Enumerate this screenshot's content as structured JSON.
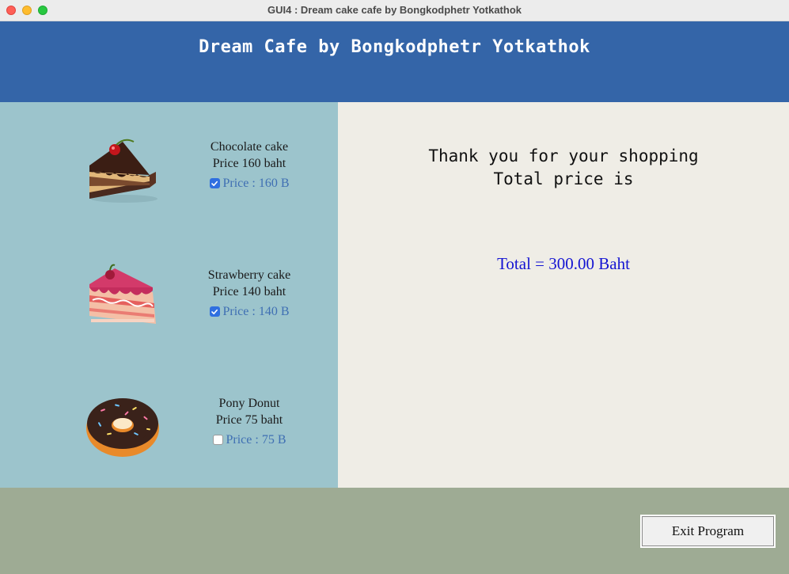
{
  "window": {
    "title": "GUI4 : Dream cake cafe by Bongkodphetr Yotkathok"
  },
  "header": {
    "title": "Dream Cafe by Bongkodphetr Yotkathok"
  },
  "items": [
    {
      "name": "Chocolate cake",
      "price_text": "Price 160 baht",
      "checkbox_label": "Price : 160 B",
      "checked": true,
      "icon": "chocolate-cake-icon"
    },
    {
      "name": "Strawberry cake",
      "price_text": "Price 140 baht",
      "checkbox_label": "Price : 140 B",
      "checked": true,
      "icon": "strawberry-cake-icon"
    },
    {
      "name": "Pony Donut",
      "price_text": "Price 75 baht",
      "checkbox_label": "Price : 75 B",
      "checked": false,
      "icon": "donut-icon"
    }
  ],
  "summary": {
    "thanks_line1": "Thank you for your shopping",
    "thanks_line2": "Total price is",
    "total": "Total = 300.00 Baht"
  },
  "footer": {
    "exit_label": "Exit Program"
  },
  "colors": {
    "header_bg": "#3465a8",
    "left_panel_bg": "#9cc4cc",
    "right_panel_bg": "#efede6",
    "footer_bg": "#9eab94",
    "total_text": "#1414d2",
    "checkbox_label": "#3f6fb3"
  }
}
